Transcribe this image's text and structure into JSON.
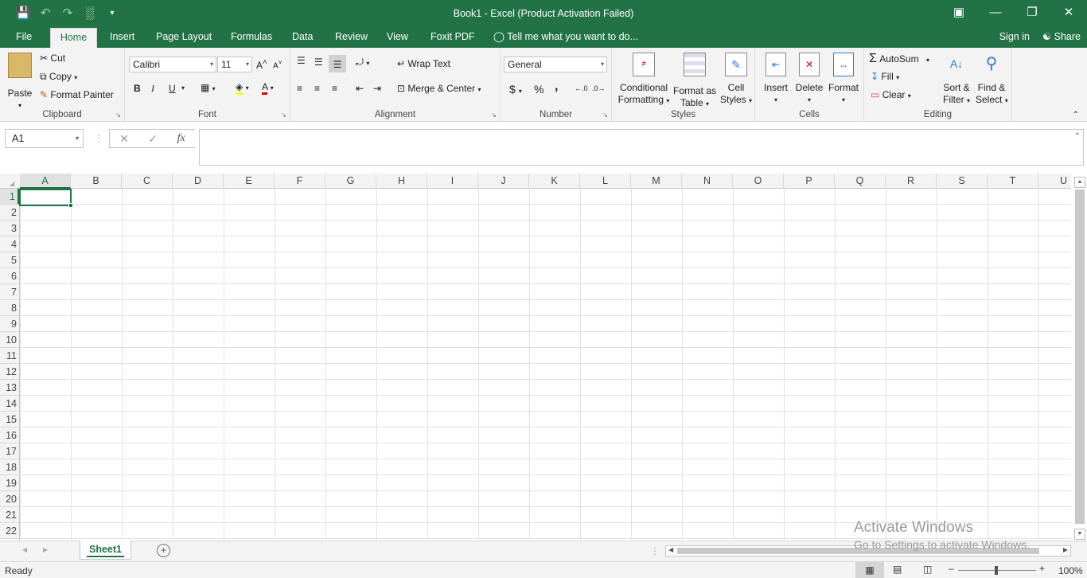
{
  "window": {
    "title": "Book1 - Excel (Product Activation Failed)",
    "qat": [
      "save-icon",
      "undo-icon",
      "redo-icon",
      "chart-icon",
      "customize-icon"
    ],
    "buttons": [
      "ribbon-display-icon",
      "minimize-icon",
      "restore-icon",
      "close-icon"
    ]
  },
  "tabs": [
    "File",
    "Home",
    "Insert",
    "Page Layout",
    "Formulas",
    "Data",
    "Review",
    "View",
    "Foxit PDF"
  ],
  "active_tab": "Home",
  "tell_me": "Tell me what you want to do...",
  "sign_in": "Sign in",
  "share": "Share",
  "ribbon": {
    "clipboard": {
      "label": "Clipboard",
      "paste": "Paste",
      "cut": "Cut",
      "copy": "Copy",
      "format_painter": "Format Painter"
    },
    "font": {
      "label": "Font",
      "name": "Calibri",
      "size": "11",
      "bold": "B",
      "italic": "I",
      "underline": "U"
    },
    "alignment": {
      "label": "Alignment",
      "wrap_text": "Wrap Text",
      "merge_center": "Merge & Center"
    },
    "number": {
      "label": "Number",
      "format": "General",
      "currency": "$",
      "percent": "%",
      "comma": ","
    },
    "styles": {
      "label": "Styles",
      "conditional_1": "Conditional",
      "conditional_2": "Formatting",
      "format_table_1": "Format as",
      "format_table_2": "Table",
      "cell_styles_1": "Cell",
      "cell_styles_2": "Styles"
    },
    "cells": {
      "label": "Cells",
      "insert": "Insert",
      "delete": "Delete",
      "format": "Format"
    },
    "editing": {
      "label": "Editing",
      "autosum": "AutoSum",
      "fill": "Fill",
      "clear": "Clear",
      "sort_1": "Sort &",
      "sort_2": "Filter",
      "find_1": "Find &",
      "find_2": "Select"
    }
  },
  "name_box": "A1",
  "formula": "",
  "columns": [
    "A",
    "B",
    "C",
    "D",
    "E",
    "F",
    "G",
    "H",
    "I",
    "J",
    "K",
    "L",
    "M",
    "N",
    "O",
    "P",
    "Q",
    "R",
    "S",
    "T",
    "U"
  ],
  "rows": [
    "1",
    "2",
    "3",
    "4",
    "5",
    "6",
    "7",
    "8",
    "9",
    "10",
    "11",
    "12",
    "13",
    "14",
    "15",
    "16",
    "17",
    "18",
    "19",
    "20",
    "21",
    "22"
  ],
  "sheet_tab": "Sheet1",
  "status": {
    "ready": "Ready",
    "zoom": "100%"
  },
  "watermark": {
    "line1": "Activate Windows",
    "line2": "Go to Settings to activate Windows."
  }
}
